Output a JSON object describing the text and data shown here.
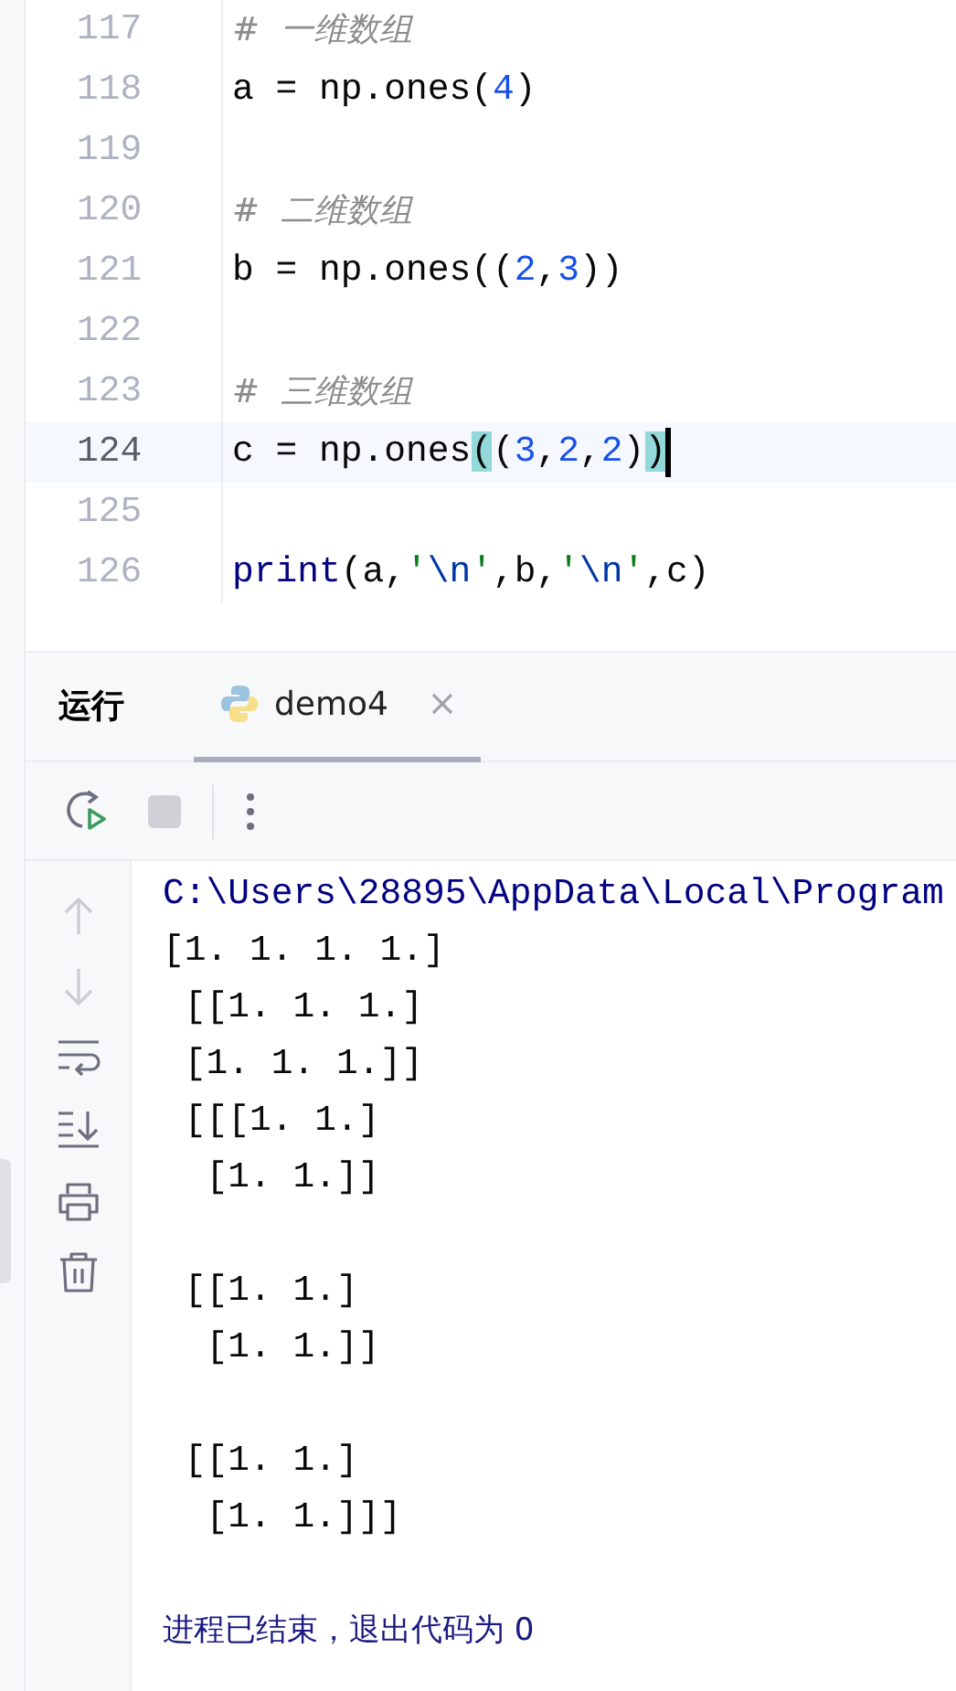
{
  "editor": {
    "lines": [
      {
        "number": "117",
        "current": false,
        "cursor": false,
        "tokens": [
          {
            "kind": "comment",
            "text": "#  一维数组"
          }
        ]
      },
      {
        "number": "118",
        "current": false,
        "cursor": false,
        "tokens": [
          {
            "kind": "plain",
            "text": "a = np.ones("
          },
          {
            "kind": "number",
            "text": "4"
          },
          {
            "kind": "plain",
            "text": ")"
          }
        ]
      },
      {
        "number": "119",
        "current": false,
        "cursor": false
      },
      {
        "number": "120",
        "current": false,
        "cursor": false,
        "tokens": [
          {
            "kind": "comment",
            "text": "#  二维数组"
          }
        ]
      },
      {
        "number": "121",
        "current": false,
        "cursor": false,
        "tokens": [
          {
            "kind": "plain",
            "text": "b = np.ones(("
          },
          {
            "kind": "number",
            "text": "2"
          },
          {
            "kind": "plain",
            "text": ","
          },
          {
            "kind": "number",
            "text": "3"
          },
          {
            "kind": "plain",
            "text": "))"
          }
        ]
      },
      {
        "number": "122",
        "current": false,
        "cursor": false
      },
      {
        "number": "123",
        "current": false,
        "cursor": false,
        "tokens": [
          {
            "kind": "comment",
            "text": "#  三维数组"
          }
        ]
      },
      {
        "number": "124",
        "current": true,
        "cursor": true,
        "tokens": [
          {
            "kind": "plain",
            "text": "c = np.ones"
          },
          {
            "kind": "match",
            "text": "("
          },
          {
            "kind": "plain",
            "text": "("
          },
          {
            "kind": "number",
            "text": "3"
          },
          {
            "kind": "plain",
            "text": ","
          },
          {
            "kind": "number",
            "text": "2"
          },
          {
            "kind": "plain",
            "text": ","
          },
          {
            "kind": "number",
            "text": "2"
          },
          {
            "kind": "plain",
            "text": ")"
          },
          {
            "kind": "match",
            "text": ")"
          }
        ]
      },
      {
        "number": "125",
        "current": false,
        "cursor": false
      },
      {
        "number": "126",
        "current": false,
        "cursor": false,
        "tokens": [
          {
            "kind": "builtin",
            "text": "print"
          },
          {
            "kind": "plain",
            "text": "(a,"
          },
          {
            "kind": "string",
            "text": "'"
          },
          {
            "kind": "escape",
            "text": "\\n"
          },
          {
            "kind": "string",
            "text": "'"
          },
          {
            "kind": "plain",
            "text": ",b,"
          },
          {
            "kind": "string",
            "text": "'"
          },
          {
            "kind": "escape",
            "text": "\\n"
          },
          {
            "kind": "string",
            "text": "'"
          },
          {
            "kind": "plain",
            "text": ",c)"
          }
        ]
      }
    ]
  },
  "run_panel": {
    "title": "运行",
    "tabs": [
      {
        "label": "demo4",
        "selected": true
      }
    ],
    "toolbar": [
      {
        "kind": "rerun",
        "disabled": false
      },
      {
        "kind": "stop",
        "disabled": true
      },
      {
        "kind": "more",
        "disabled": false
      }
    ],
    "console_tools": [
      {
        "kind": "up",
        "disabled": true
      },
      {
        "kind": "down",
        "disabled": true
      },
      {
        "kind": "wrap",
        "disabled": false
      },
      {
        "kind": "scroll-end",
        "disabled": false
      },
      {
        "kind": "print",
        "disabled": false
      },
      {
        "kind": "delete",
        "disabled": false
      }
    ],
    "output": [
      {
        "kind": "system",
        "text": "C:\\Users\\28895\\AppData\\Local\\Program"
      },
      {
        "kind": "stdout",
        "text": "[1. 1. 1. 1.]"
      },
      {
        "kind": "stdout",
        "text": " [[1. 1. 1.]"
      },
      {
        "kind": "stdout",
        "text": " [1. 1. 1.]]"
      },
      {
        "kind": "stdout",
        "text": " [[[1. 1.]"
      },
      {
        "kind": "stdout",
        "text": "  [1. 1.]]"
      },
      {
        "kind": "stdout"
      },
      {
        "kind": "stdout",
        "text": " [[1. 1.]"
      },
      {
        "kind": "stdout",
        "text": "  [1. 1.]]"
      },
      {
        "kind": "stdout"
      },
      {
        "kind": "stdout",
        "text": " [[1. 1.]"
      },
      {
        "kind": "stdout",
        "text": "  [1. 1.]]]"
      },
      {
        "kind": "stdout"
      },
      {
        "kind": "system",
        "text": "进程已结束，退出代码为 0"
      }
    ]
  }
}
